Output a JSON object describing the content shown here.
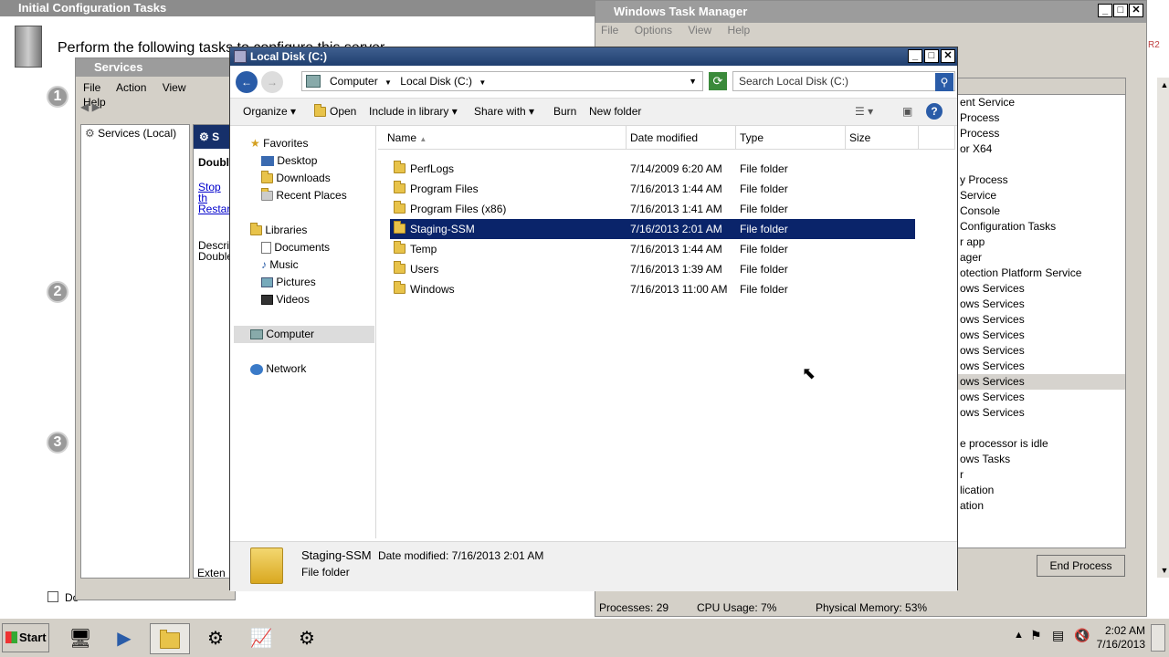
{
  "initial_config": {
    "title": "Initial Configuration Tasks",
    "heading": "Perform the following tasks to configure this server",
    "steps": [
      "1",
      "2",
      "3"
    ],
    "bottom_checkbox_label": "Do"
  },
  "task_manager": {
    "title": "Windows Task Manager",
    "menu": [
      "File",
      "Options",
      "View",
      "Help"
    ],
    "processes": [
      "ent Service",
      "Process",
      "Process",
      "or X64",
      "",
      "y Process",
      "Service",
      "Console",
      "Configuration Tasks",
      "r app",
      "ager",
      "otection Platform Service",
      "ows Services",
      "ows Services",
      "ows Services",
      "ows Services",
      "ows Services",
      "ows Services",
      "ows Services",
      "ows Services",
      "ows Services",
      "",
      "e processor is idle",
      "ows Tasks",
      "r",
      "lication",
      "ation"
    ],
    "selected_process_index": 18,
    "end_process_label": "End Process",
    "status": {
      "processes": "Processes: 29",
      "cpu": "CPU Usage: 7%",
      "memory": "Physical Memory: 53%"
    },
    "edge_text": "R2"
  },
  "services": {
    "title": "Services",
    "menu": [
      "File",
      "Action",
      "View",
      "Help"
    ],
    "tree_root": "Services (Local)",
    "detail_heading": "Double",
    "detail_links": [
      "Stop th",
      "Restart"
    ],
    "detail_desc": [
      "Descrip",
      "Double"
    ],
    "detail_tab": "Exten",
    "detail_s": "S"
  },
  "explorer": {
    "title": "Local Disk (C:)",
    "breadcrumb": [
      "Computer",
      "Local Disk (C:)"
    ],
    "search_placeholder": "Search Local Disk (C:)",
    "toolbar": {
      "organize": "Organize",
      "open": "Open",
      "include": "Include in library",
      "share": "Share with",
      "burn": "Burn",
      "new_folder": "New folder"
    },
    "nav": {
      "favorites": "Favorites",
      "desktop": "Desktop",
      "downloads": "Downloads",
      "recent": "Recent Places",
      "libraries": "Libraries",
      "documents": "Documents",
      "music": "Music",
      "pictures": "Pictures",
      "videos": "Videos",
      "computer": "Computer",
      "network": "Network"
    },
    "columns": {
      "name": "Name",
      "date": "Date modified",
      "type": "Type",
      "size": "Size"
    },
    "files": [
      {
        "name": "PerfLogs",
        "date": "7/14/2009 6:20 AM",
        "type": "File folder"
      },
      {
        "name": "Program Files",
        "date": "7/16/2013 1:44 AM",
        "type": "File folder"
      },
      {
        "name": "Program Files (x86)",
        "date": "7/16/2013 1:41 AM",
        "type": "File folder"
      },
      {
        "name": "Staging-SSM",
        "date": "7/16/2013 2:01 AM",
        "type": "File folder"
      },
      {
        "name": "Temp",
        "date": "7/16/2013 1:44 AM",
        "type": "File folder"
      },
      {
        "name": "Users",
        "date": "7/16/2013 1:39 AM",
        "type": "File folder"
      },
      {
        "name": "Windows",
        "date": "7/16/2013 11:00 AM",
        "type": "File folder"
      }
    ],
    "selected_index": 3,
    "details": {
      "name": "Staging-SSM",
      "date_label": "Date modified:",
      "date_value": "7/16/2013 2:01 AM",
      "type": "File folder"
    }
  },
  "taskbar": {
    "start": "Start",
    "time": "2:02 AM",
    "date": "7/16/2013"
  }
}
